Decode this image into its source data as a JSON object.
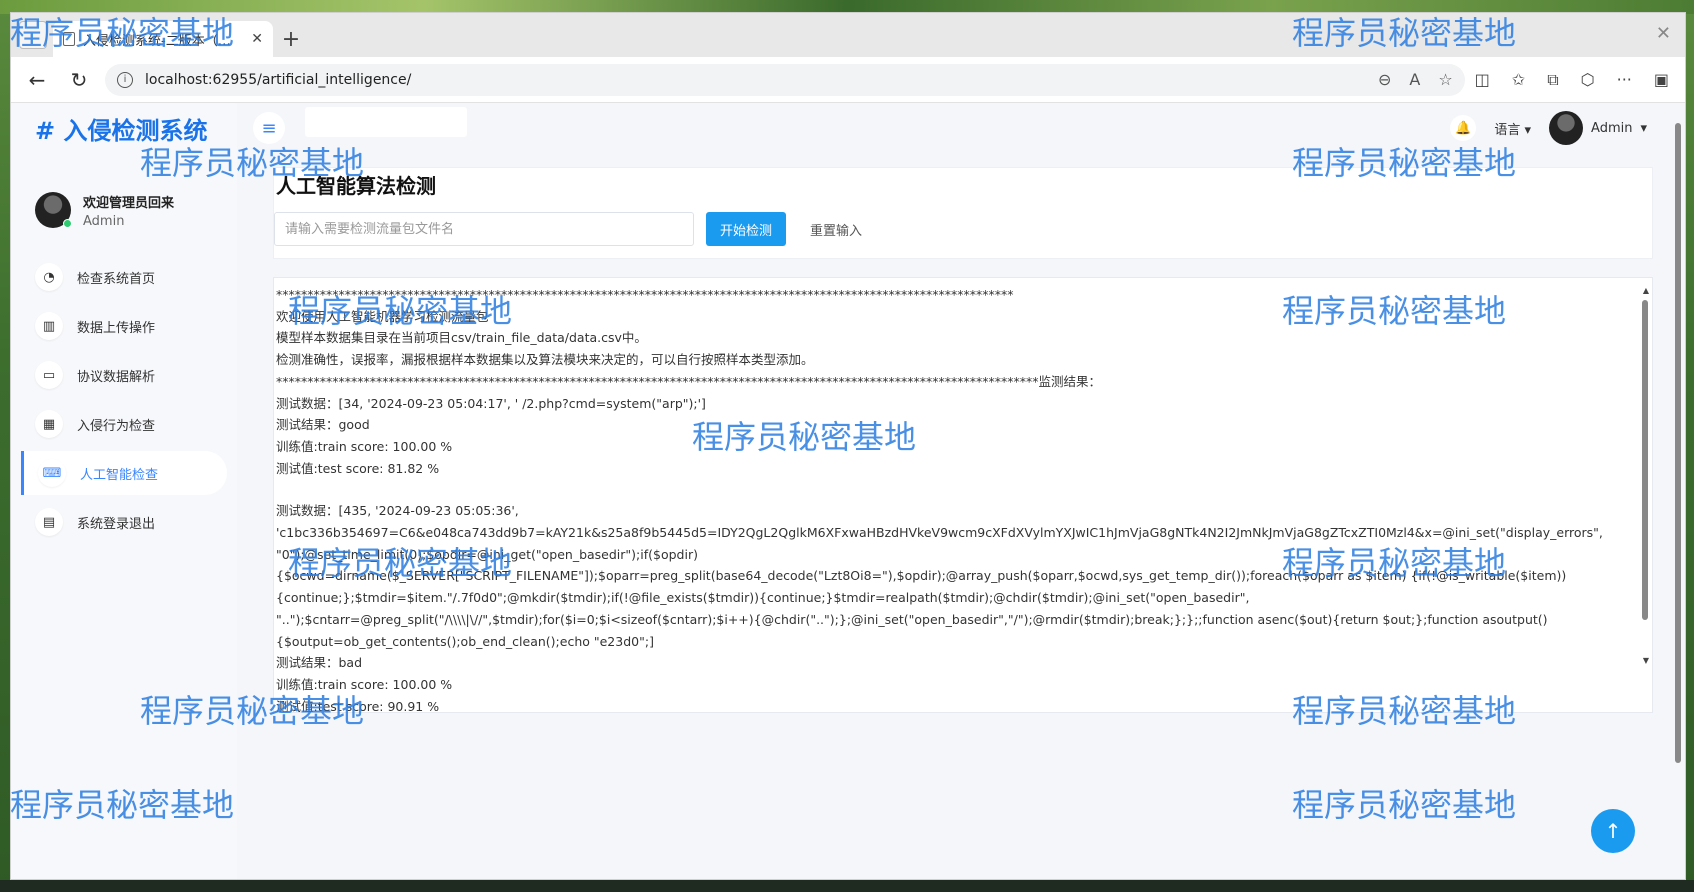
{
  "browser": {
    "tab_title": "入侵检测系统-二版本（支持加密）",
    "url": "localhost:62955/artificial_intelligence/"
  },
  "sidebar": {
    "brand": "# 入侵检测系统",
    "welcome": "欢迎管理员回来",
    "role": "Admin",
    "items": [
      {
        "label": "检查系统首页",
        "icon": "dashboard-icon",
        "glyph": "◔"
      },
      {
        "label": "数据上传操作",
        "icon": "bar-chart-icon",
        "glyph": "▥"
      },
      {
        "label": "协议数据解析",
        "icon": "laptop-icon",
        "glyph": "▭"
      },
      {
        "label": "入侵行为检查",
        "icon": "grid-icon",
        "glyph": "▦"
      },
      {
        "label": "人工智能检查",
        "icon": "keyboard-icon",
        "glyph": "⌨"
      },
      {
        "label": "系统登录退出",
        "icon": "file-icon",
        "glyph": "▤"
      }
    ]
  },
  "header": {
    "language": "语言",
    "user": "Admin"
  },
  "main": {
    "title": "人工智能算法检测",
    "input_placeholder": "请输入需要检测流量包文件名",
    "start_button": "开始检测",
    "reset_button": "重置输入"
  },
  "result_lines": [
    "**********************************************************************************************************************",
    "欢迎使用人工智能机器学习检测流量包",
    "模型样本数据集目录在当前项目csv/train_file_data/data.csv中。",
    "检测准确性，误报率，漏报根据样本数据集以及算法模块来决定的，可以自行按照样本类型添加。",
    "**************************************************************************************************************************监测结果：",
    "测试数据：[34, '2024-09-23 05:04:17', ' /2.php?cmd=system(\"arp\");']",
    "测试结果：good",
    "训练值:train score: 100.00 %",
    "测试值:test score: 81.82 %",
    "",
    "测试数据：[435, '2024-09-23 05:05:36',",
    "'c1bc336b354697=C6&e048ca743dd9b7=kAY21k&s25a8f9b5445d5=IDY2QgL2QglkM6XFxwaHBzdHVkeV9wcm9cXFdXVylmYXJwIC1hJmVjaG8gNTk4N2I2JmNkJmVjaG8gZTcxZTI0Mzl4&x=@ini_set(\"display_errors\",",
    "\"0\");@set_time_limit(0);$opdir=@ini_get(\"open_basedir\");if($opdir)",
    "{$ocwd=dirname($_SERVER[\"SCRIPT_FILENAME\"]);$oparr=preg_split(base64_decode(\"Lzt8Oi8=\"),$opdir);@array_push($oparr,$ocwd,sys_get_temp_dir());foreach($oparr as $item) {if(!@is_writable($item))",
    "{continue;};$tmdir=$item.\"/.7f0d0\";@mkdir($tmdir);if(!@file_exists($tmdir)){continue;}$tmdir=realpath($tmdir);@chdir($tmdir);@ini_set(\"open_basedir\",",
    "\"..\");$cntarr=@preg_split(\"/\\\\\\\\|\\//\",$tmdir);for($i=0;$i<sizeof($cntarr);$i++){@chdir(\"..\");};@ini_set(\"open_basedir\",\"/\");@rmdir($tmdir);break;};};;function asenc($out){return $out;};function asoutput()",
    "{$output=ob_get_contents();ob_end_clean();echo \"e23d0\";]",
    "测试结果：bad",
    "训练值:train score: 100.00 %",
    "测试值:test score: 90.91 %"
  ],
  "watermark": "程序员秘密基地"
}
